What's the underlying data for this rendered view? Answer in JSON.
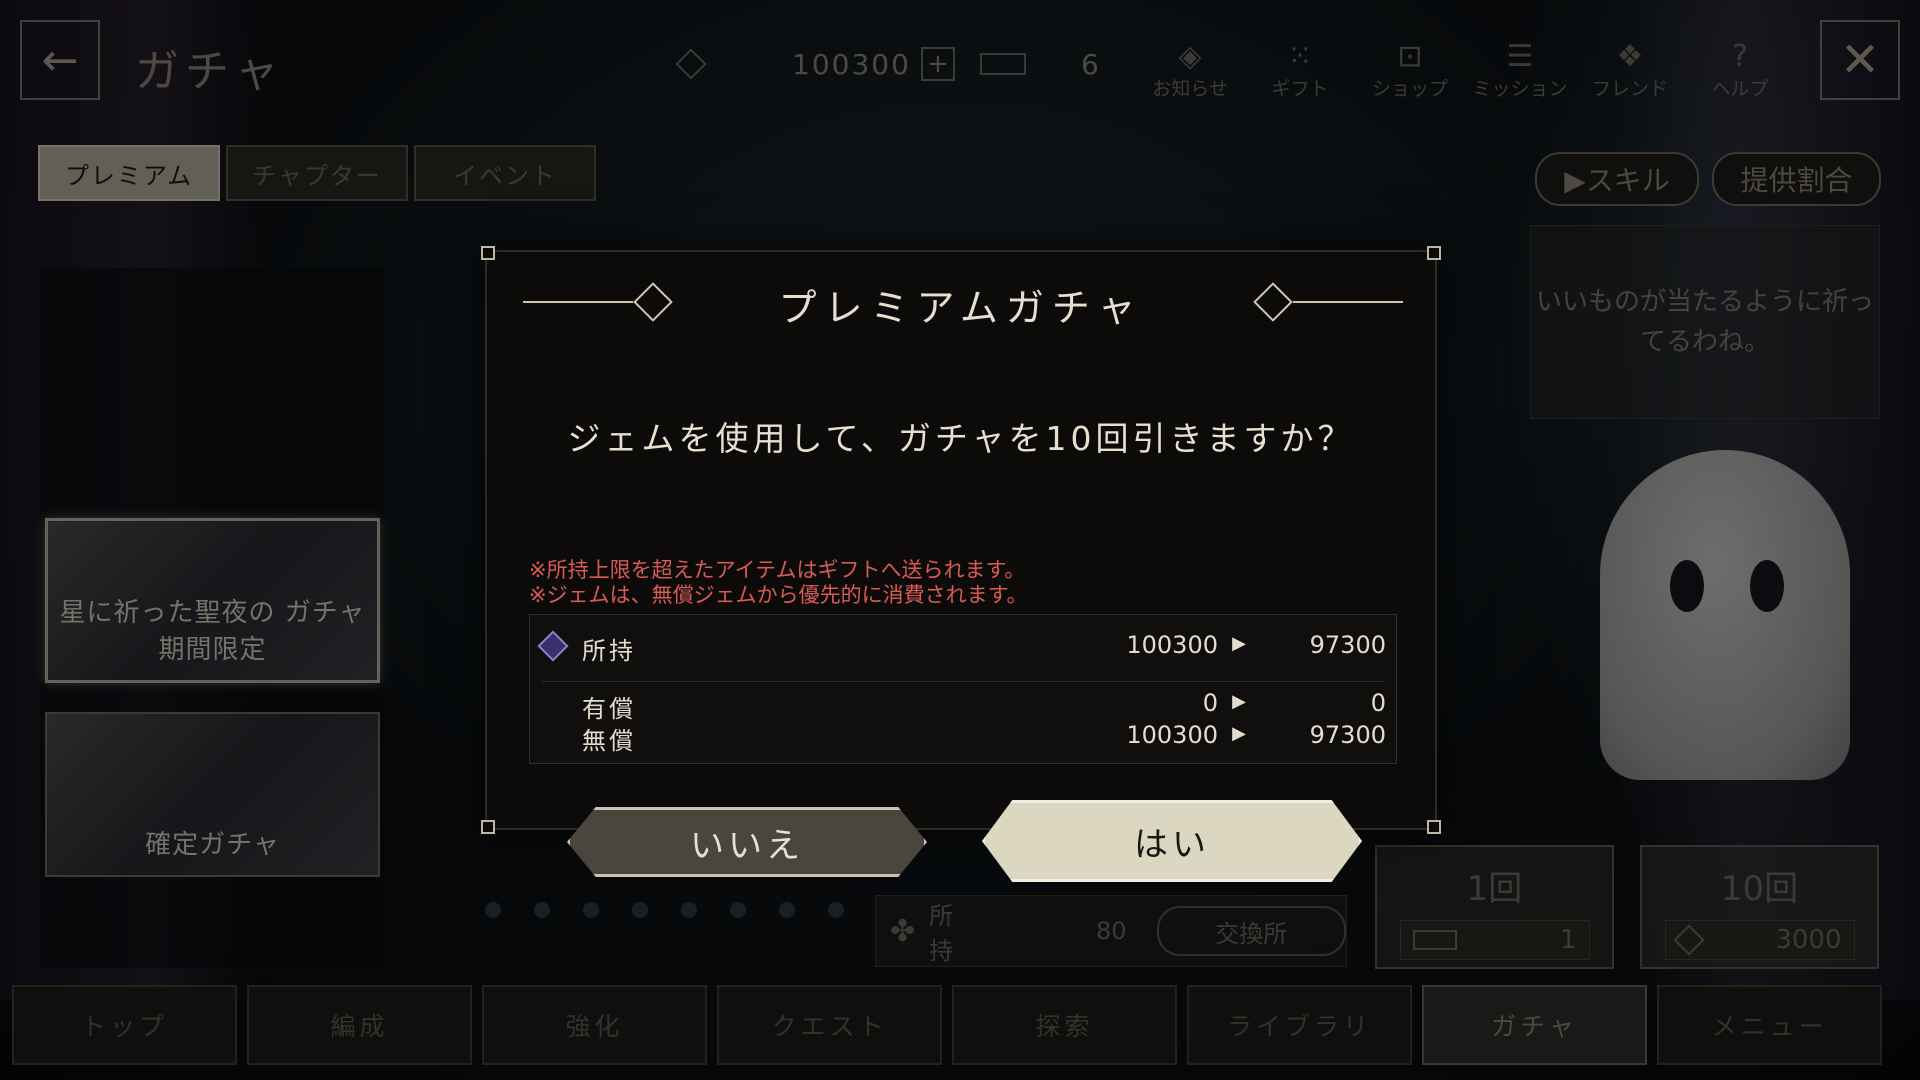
{
  "header": {
    "back_icon": "arrow-left-icon",
    "title": "ガチャ",
    "gems": "100300",
    "ticket_count": "6",
    "nav": [
      {
        "label": "お知らせ",
        "icon": "diamond-icon",
        "glyph": "◈"
      },
      {
        "label": "ギフト",
        "icon": "gift-icon",
        "glyph": "⁙"
      },
      {
        "label": "ショップ",
        "icon": "shop-icon",
        "glyph": "⊡"
      },
      {
        "label": "ミッション",
        "icon": "mission-icon",
        "glyph": "☰"
      },
      {
        "label": "フレンド",
        "icon": "friend-icon",
        "glyph": "❖"
      },
      {
        "label": "ヘルプ",
        "icon": "help-icon",
        "glyph": "?"
      }
    ],
    "close_icon": "close-icon"
  },
  "tabs": [
    "プレミアム",
    "チャプター",
    "イベント"
  ],
  "banners": [
    {
      "label": "星に祈った聖夜の ガチャ 期間限定"
    },
    {
      "label": "確定ガチャ"
    }
  ],
  "side": {
    "skill_label": "▶スキル",
    "rate_label": "提供割合",
    "speech": "いいものが当たるように祈ってるわね。"
  },
  "pulls": {
    "single": {
      "label": "1回",
      "cost": "1"
    },
    "ten": {
      "label": "10回",
      "cost": "3000"
    }
  },
  "owned": {
    "label": "所持",
    "value": "80",
    "exchange": "交換所"
  },
  "bottom_nav": [
    "トップ",
    "編成",
    "強化",
    "クエスト",
    "探索",
    "ライブラリ",
    "ガチャ",
    "メニュー"
  ],
  "dialog": {
    "title": "プレミアムガチャ",
    "question": "ジェムを使用して、ガチャを10回引きますか？",
    "notes": [
      "※所持上限を超えたアイテムはギフトへ送られます。",
      "※ジェムは、無償ジェムから優先的に消費されます。"
    ],
    "rows": [
      {
        "label": "所持",
        "before": "100300",
        "after": "97300"
      },
      {
        "label": "有償",
        "before": "0",
        "after": "0"
      },
      {
        "label": "無償",
        "before": "100300",
        "after": "97300"
      }
    ],
    "no_label": "いいえ",
    "yes_label": "はい"
  }
}
